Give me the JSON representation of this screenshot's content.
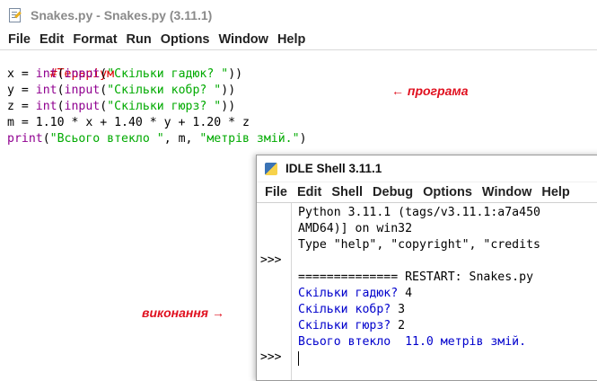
{
  "editor": {
    "title": "Snakes.py - Snakes.py (3.11.1)",
    "menu": [
      "File",
      "Edit",
      "Format",
      "Run",
      "Options",
      "Window",
      "Help"
    ],
    "code": {
      "l1": {
        "comment": "#Тераріум"
      },
      "l2": {
        "a": "x = ",
        "b": "int",
        "c": "(",
        "d": "input",
        "e": "(",
        "f": "\"Скільки гадюк? \"",
        "g": "))"
      },
      "l3": {
        "a": "y = ",
        "b": "int",
        "c": "(",
        "d": "input",
        "e": "(",
        "f": "\"Скільки кобр? \"",
        "g": "))"
      },
      "l4": {
        "a": "z = ",
        "b": "int",
        "c": "(",
        "d": "input",
        "e": "(",
        "f": "\"Скільки гюрз? \"",
        "g": "))"
      },
      "l5": {
        "a": "m = 1.10 * x + 1.40 * y + 1.20 * z"
      },
      "l6": {
        "a": "print",
        "b": "(",
        "c": "\"Всього втекло \"",
        "d": ", m, ",
        "e": "\"метрів змій.\"",
        "f": ")"
      }
    }
  },
  "annotations": {
    "program": "← програма",
    "execution": "виконання →"
  },
  "shell": {
    "title": "IDLE Shell 3.11.1",
    "menu": [
      "File",
      "Edit",
      "Shell",
      "Debug",
      "Options",
      "Window",
      "Help"
    ],
    "prompt": ">>>",
    "lines": [
      "Python 3.11.1 (tags/v3.11.1:a7a450",
      "AMD64)] on win32",
      "Type \"help\", \"copyright\", \"credits",
      "============== RESTART: Snakes.py",
      "Скільки гадюк? ",
      "Скільки кобр? ",
      "Скільки гюрз? ",
      "Всього втекло  11.0 метрів змій."
    ],
    "inputs": [
      "4",
      "3",
      "2"
    ]
  },
  "colors": {
    "comment": "#dd0000",
    "builtin": "#900090",
    "string": "#00aa00",
    "shell_output": "#0000cc",
    "annotation": "#e0101f"
  }
}
